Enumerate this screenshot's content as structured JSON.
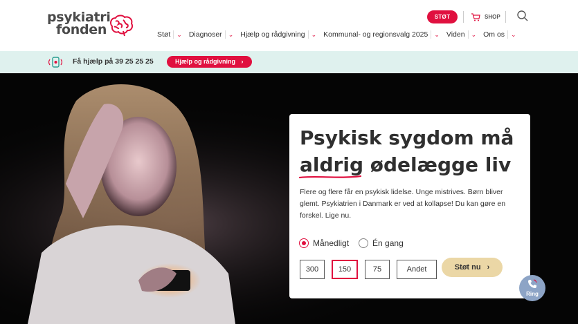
{
  "header": {
    "logo_line1": "psykiatri",
    "logo_line2": "fonden",
    "stoet_label": "STØT",
    "shop_label": "SHOP",
    "nav": [
      {
        "label": "Støt"
      },
      {
        "label": "Diagnoser"
      },
      {
        "label": "Hjælp og rådgivning"
      },
      {
        "label": "Kommunal- og regionsvalg 2025"
      },
      {
        "label": "Viden"
      },
      {
        "label": "Om os"
      }
    ]
  },
  "helpbar": {
    "text": "Få hjælp på 39 25 25 25",
    "button_label": "Hjælp og rådgivning"
  },
  "hero": {
    "title_line1": "Psykisk sygdom må",
    "title_word_underlined": "aldrig",
    "title_rest": " ødelægge liv",
    "body": "Flere og flere får en psykisk lidelse. Unge mistrives. Børn bliver glemt. Psykiatrien i Danmark er ved at kollapse! Du kan gøre en forskel. Lige nu.",
    "frequency_options": [
      {
        "label": "Månedligt",
        "selected": true
      },
      {
        "label": "Én gang",
        "selected": false
      }
    ],
    "amounts": [
      {
        "label": "300",
        "selected": false
      },
      {
        "label": "150",
        "selected": true
      },
      {
        "label": "75",
        "selected": false
      },
      {
        "label": "Andet",
        "selected": false
      }
    ],
    "donate_label": "Støt nu",
    "ring_label": "Ring"
  },
  "colors": {
    "brand_red": "#e0103f",
    "helpbar_bg": "#dff1ee",
    "donate_btn": "#ebd7a6",
    "ring_btn": "#8da4c6"
  }
}
